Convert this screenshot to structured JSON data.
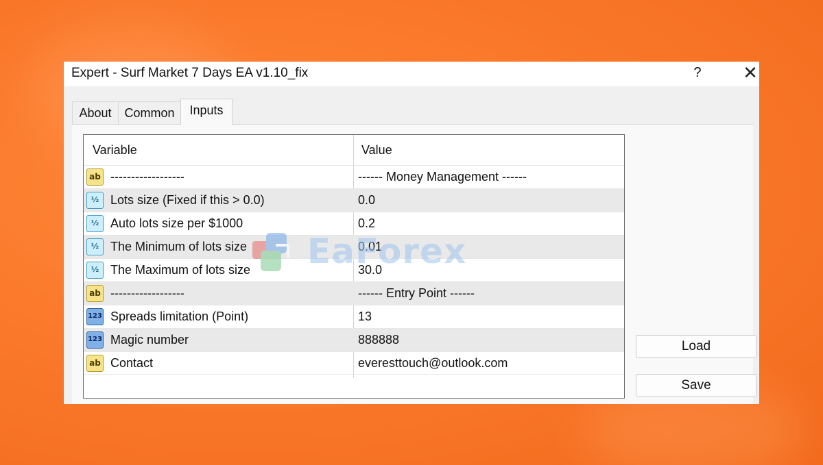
{
  "window": {
    "title": "Expert - Surf Market 7 Days EA v1.10_fix",
    "help_label": "?",
    "close_label": "✕"
  },
  "tabs": [
    {
      "label": "About",
      "active": false
    },
    {
      "label": "Common",
      "active": false
    },
    {
      "label": "Inputs",
      "active": true
    }
  ],
  "grid": {
    "headers": {
      "variable": "Variable",
      "value": "Value"
    },
    "rows": [
      {
        "icon": "string-type-icon",
        "icon_text": "ab",
        "variable": "------------------",
        "value": "------ Money Management ------"
      },
      {
        "icon": "double-type-icon",
        "icon_text": "½",
        "variable": "Lots size (Fixed if this > 0.0)",
        "value": "0.0"
      },
      {
        "icon": "double-type-icon",
        "icon_text": "½",
        "variable": "Auto lots size per $1000",
        "value": "0.2"
      },
      {
        "icon": "double-type-icon",
        "icon_text": "½",
        "variable": "The Minimum of lots size",
        "value": "0.01"
      },
      {
        "icon": "double-type-icon",
        "icon_text": "½",
        "variable": "The Maximum of lots size",
        "value": "30.0"
      },
      {
        "icon": "string-type-icon",
        "icon_text": "ab",
        "variable": "------------------",
        "value": "------ Entry Point ------"
      },
      {
        "icon": "integer-type-icon",
        "icon_text": "123",
        "variable": "Spreads limitation (Point)",
        "value": "13"
      },
      {
        "icon": "integer-type-icon",
        "icon_text": "123",
        "variable": "Magic number",
        "value": "888888"
      },
      {
        "icon": "string-type-icon",
        "icon_text": "ab",
        "variable": "Contact",
        "value": "everesttouch@outlook.com"
      }
    ]
  },
  "buttons": {
    "load": "Load",
    "save": "Save"
  },
  "watermark": {
    "text": "EaForex"
  },
  "colors": {
    "background": "#fb7a2c",
    "accent_blue": "#7fb0e6"
  }
}
